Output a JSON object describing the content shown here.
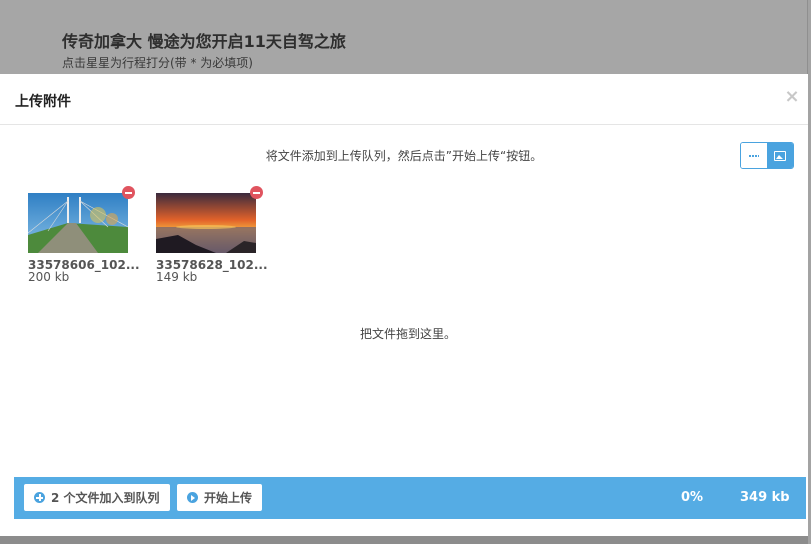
{
  "background": {
    "title": "传奇加拿大 慢途为您开启11天自驾之旅",
    "subtitle": "点击星星为行程打分(带 * 为必填项)"
  },
  "modal": {
    "title": "上传附件",
    "close_label": "×",
    "instructions": "将文件添加到上传队列，然后点击”开始上传“按钮。",
    "drop_text": "把文件拖到这里。",
    "view_modes": [
      "list-view-icon",
      "thumbnail-view-icon"
    ],
    "files": [
      {
        "name": "33578606_102...",
        "size": "200 kb"
      },
      {
        "name": "33578628_102...",
        "size": "149 kb"
      }
    ]
  },
  "footer": {
    "add_button_label": "2 个文件加入到队列",
    "start_button_label": "开始上传",
    "progress": "0%",
    "total_size": "349 kb"
  },
  "colors": {
    "accent": "#55ace4",
    "remove": "#e0545f"
  }
}
